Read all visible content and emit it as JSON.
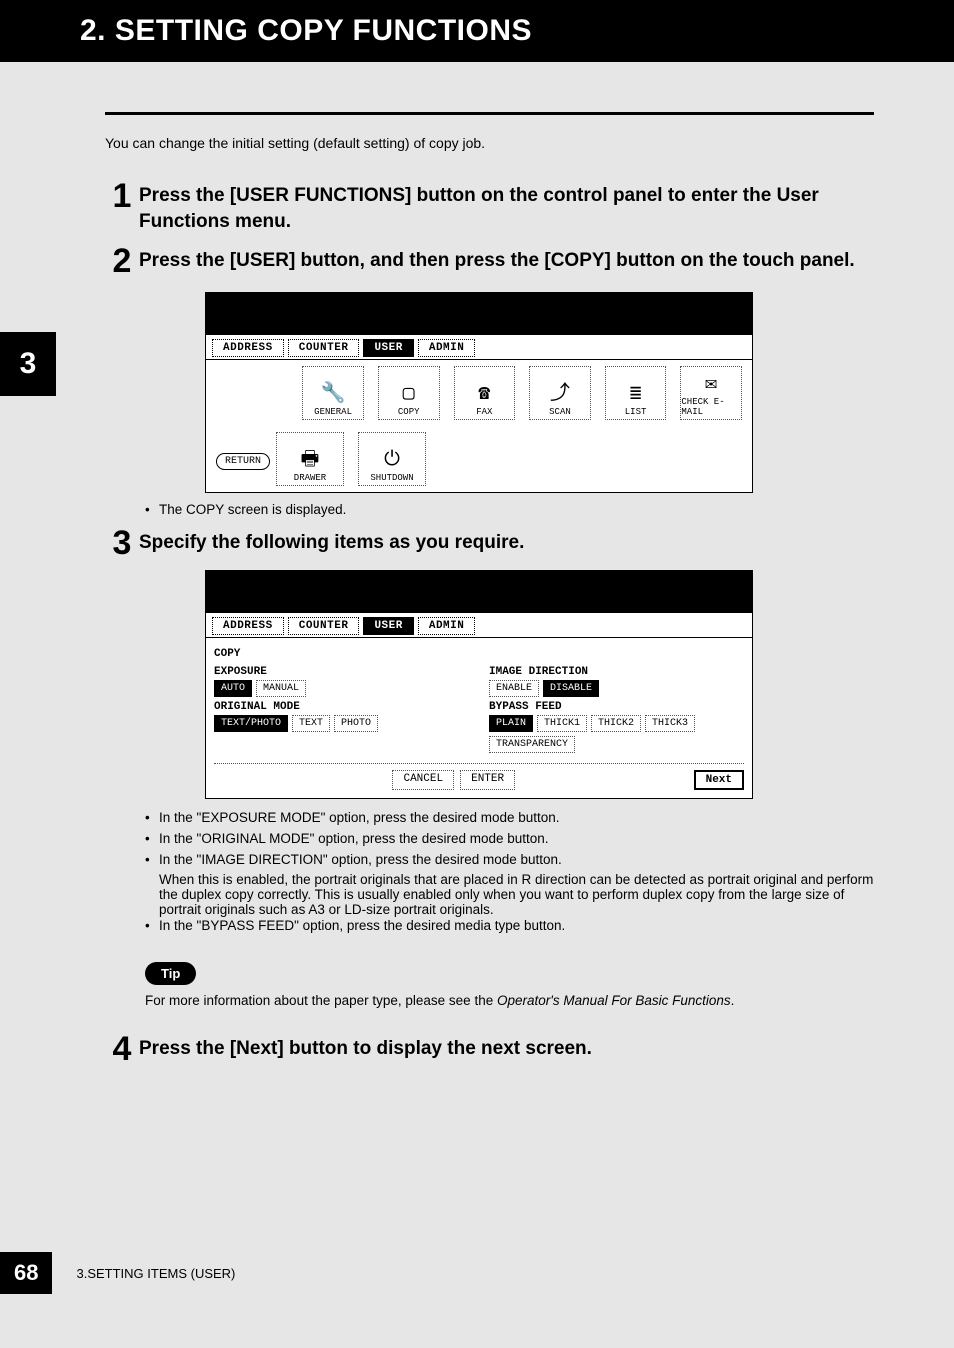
{
  "title": "2. SETTING COPY FUNCTIONS",
  "intro": "You can change the initial setting (default setting) of copy job.",
  "side_tab": "3",
  "steps": {
    "s1": {
      "num": "1",
      "text": "Press the [USER FUNCTIONS] button on the control panel to enter the User Functions menu."
    },
    "s2": {
      "num": "2",
      "text": "Press the [USER] button, and then press the [COPY] button on the touch panel."
    },
    "s3": {
      "num": "3",
      "text": "Specify the following items as you require."
    },
    "s4": {
      "num": "4",
      "text": "Press the [Next] button to display the next screen."
    }
  },
  "screenshot1": {
    "tabs": [
      "ADDRESS",
      "COUNTER",
      "USER",
      "ADMIN"
    ],
    "active_tab": "USER",
    "return_label": "RETURN",
    "icons_row1": [
      {
        "label": "GENERAL",
        "glyph": "🔧"
      },
      {
        "label": "COPY",
        "glyph": "▢"
      },
      {
        "label": "FAX",
        "glyph": "☎"
      },
      {
        "label": "SCAN",
        "glyph": "⤴"
      },
      {
        "label": "LIST",
        "glyph": "≣"
      },
      {
        "label": "CHECK E-MAIL",
        "glyph": "✉"
      }
    ],
    "icons_row2": [
      {
        "label": "DRAWER",
        "glyph": "🖶"
      },
      {
        "label": "SHUTDOWN",
        "glyph": "⏻"
      }
    ]
  },
  "after_ss1": "The COPY screen is displayed.",
  "screenshot2": {
    "tabs": [
      "ADDRESS",
      "COUNTER",
      "USER",
      "ADMIN"
    ],
    "active_tab": "USER",
    "heading": "COPY",
    "left": {
      "exposure_label": "EXPOSURE",
      "exposure_opts": [
        "AUTO",
        "MANUAL"
      ],
      "exposure_sel": "AUTO",
      "orig_label": "ORIGINAL MODE",
      "orig_opts": [
        "TEXT/PHOTO",
        "TEXT",
        "PHOTO"
      ],
      "orig_sel": "TEXT/PHOTO"
    },
    "right": {
      "imgdir_label": "IMAGE DIRECTION",
      "imgdir_opts": [
        "ENABLE",
        "DISABLE"
      ],
      "imgdir_sel": "DISABLE",
      "bypass_label": "BYPASS FEED",
      "bypass_opts": [
        "PLAIN",
        "THICK1",
        "THICK2",
        "THICK3",
        "TRANSPARENCY"
      ],
      "bypass_sel": "PLAIN"
    },
    "footer": {
      "cancel": "CANCEL",
      "enter": "ENTER",
      "next": "Next"
    }
  },
  "bullets": {
    "b1": "In the \"EXPOSURE MODE\" option, press the desired mode button.",
    "b2": "In the \"ORIGINAL MODE\" option, press the desired mode button.",
    "b3": "In the \"IMAGE DIRECTION\" option, press the desired mode button.",
    "b3c": "When this is enabled, the portrait originals that are placed in R direction can be detected as portrait original and perform the duplex copy correctly.  This is usually enabled only when you want to perform duplex copy from the large size of portrait originals such as A3 or LD-size portrait originals.",
    "b4": "In the \"BYPASS FEED\" option, press the desired media type button."
  },
  "tip": {
    "label": "Tip",
    "text_a": "For more information about the paper type, please see the ",
    "text_b": "Operator's Manual For Basic Functions",
    "text_c": "."
  },
  "footer": {
    "page": "68",
    "text": "3.SETTING ITEMS (USER)"
  }
}
